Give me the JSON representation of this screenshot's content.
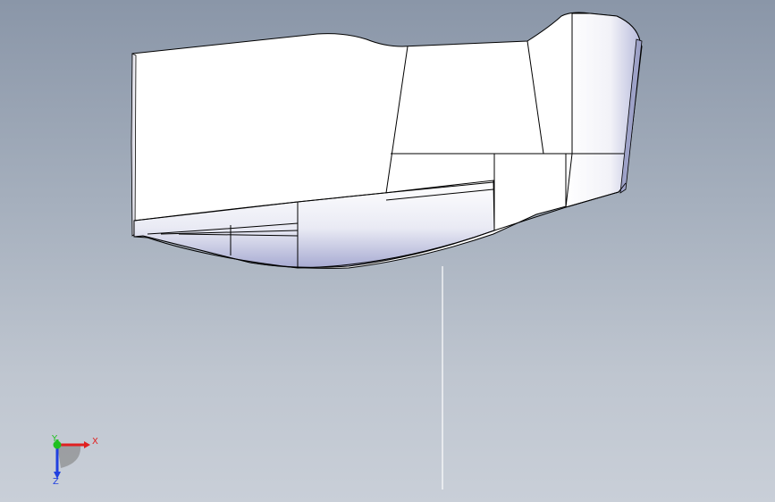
{
  "triad": {
    "x_label": "X",
    "y_label": "Y",
    "z_label": "Z",
    "x_color": "#e02020",
    "y_color": "#20c020",
    "z_color": "#2040e0"
  },
  "model": {
    "face_color": "#ffffff",
    "edge_color": "#000000",
    "shade_color": "#9a9ec8"
  }
}
